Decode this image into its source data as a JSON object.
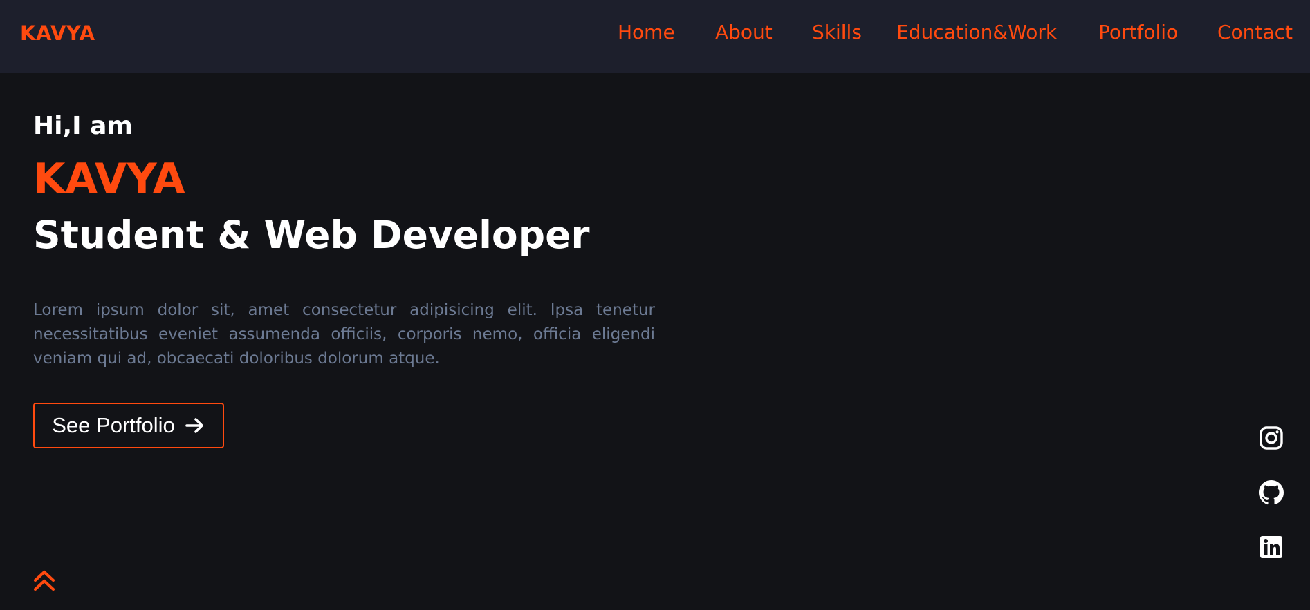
{
  "colors": {
    "accent": "#ff4a0f",
    "nav_background": "#1d1f2c",
    "page_background": "#121317",
    "description_text": "#6c7a93",
    "heading_text": "#ffffff"
  },
  "nav": {
    "logo": "KAVYA",
    "links": [
      "Home",
      "About",
      "Skills",
      "Education&Work",
      "Portfolio",
      "Contact"
    ]
  },
  "hero": {
    "greeting": "Hi,I am",
    "name": "KAVYA",
    "role": "Student & Web Developer",
    "description": "Lorem ipsum dolor sit, amet consectetur adipisicing elit. Ipsa tenetur necessitatibus eveniet assumenda officiis, corporis nemo, officia eligendi veniam qui ad, obcaecati doloribus dolorum atque.",
    "cta_label": "See Portfolio",
    "cta_icon": "arrow-right-icon"
  },
  "social": [
    "instagram-icon",
    "github-icon",
    "linkedin-icon"
  ],
  "scroll_top_icon": "double-chevron-up-icon"
}
